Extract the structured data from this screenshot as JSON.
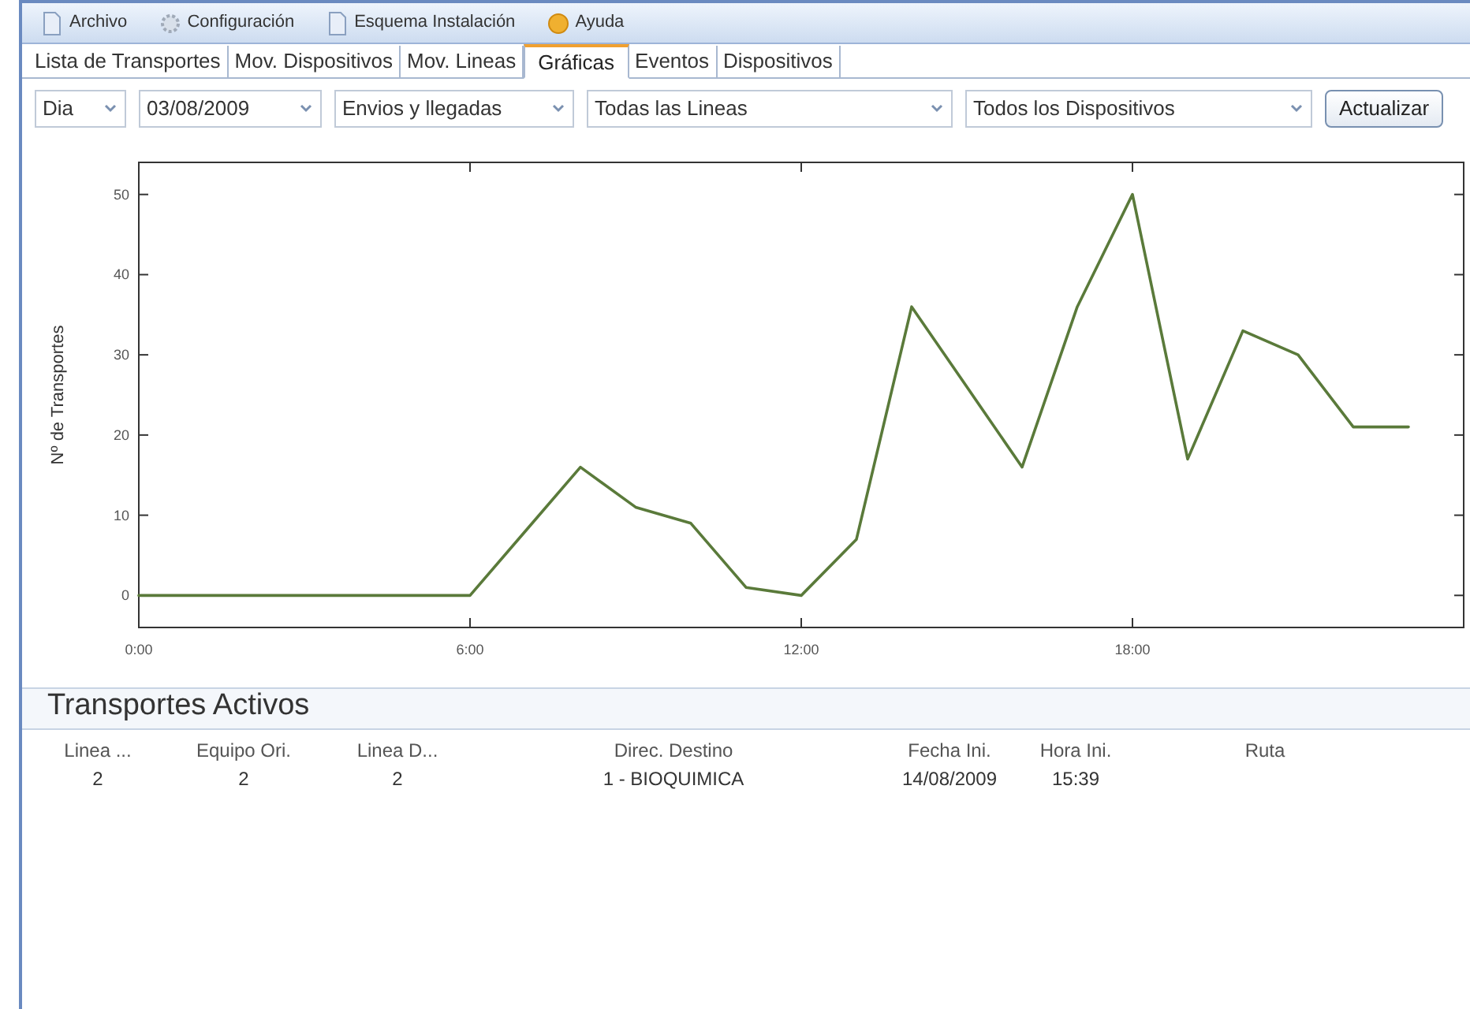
{
  "menu": [
    {
      "label": "Archivo",
      "kind": "doc"
    },
    {
      "label": "Configuración",
      "kind": "gear"
    },
    {
      "label": "Esquema Instalación",
      "kind": "doc"
    },
    {
      "label": "Ayuda",
      "kind": "help"
    }
  ],
  "tabs": [
    {
      "label": "Lista de Transportes",
      "selected": false
    },
    {
      "label": "Mov. Dispositivos",
      "selected": false
    },
    {
      "label": "Mov. Lineas",
      "selected": false
    },
    {
      "label": "Gráficas",
      "selected": true
    },
    {
      "label": "Eventos",
      "selected": false
    },
    {
      "label": "Dispositivos",
      "selected": false
    }
  ],
  "filters": [
    {
      "value": "Dia"
    },
    {
      "value": "03/08/2009"
    },
    {
      "value": "Envios y llegadas"
    },
    {
      "value": "Todas las Lineas"
    },
    {
      "value": "Todos los Dispositivos"
    }
  ],
  "update_button": "Actualizar",
  "chart": {
    "chart_data": {
      "type": "line",
      "ylabel": "Nº de Transportes",
      "x": [
        0,
        1,
        2,
        3,
        4,
        5,
        6,
        7,
        8,
        9,
        10,
        11,
        12,
        13,
        14,
        15,
        16,
        17,
        18,
        19,
        20,
        21,
        22,
        23
      ],
      "series": [
        {
          "color": "#5a7a3a",
          "values": [
            0,
            0,
            0,
            0,
            0,
            0,
            0,
            8,
            16,
            11,
            9,
            1,
            0,
            7,
            36,
            26,
            16,
            36,
            50,
            17,
            33,
            30,
            21,
            21
          ]
        }
      ],
      "xlim": [
        0,
        24
      ],
      "ylim": [
        -4,
        54
      ],
      "xticks": [
        {
          "value": 0,
          "label": "0:00"
        },
        {
          "value": 6,
          "label": "6:00"
        },
        {
          "value": 12,
          "label": "12:00"
        },
        {
          "value": 18,
          "label": "18:00"
        }
      ],
      "yticks": [
        0,
        10,
        20,
        30,
        40,
        50
      ]
    }
  },
  "active_transports": {
    "title": "Transportes Activos",
    "columns": [
      "Linea ...",
      "Equipo Ori.",
      "Linea D...",
      "Direc. Destino",
      "Fecha Ini.",
      "Hora Ini.",
      "Ruta"
    ],
    "rows": [
      [
        "2",
        "2",
        "2",
        "1 - BIOQUIMICA",
        "14/08/2009",
        "15:39"
      ]
    ]
  }
}
